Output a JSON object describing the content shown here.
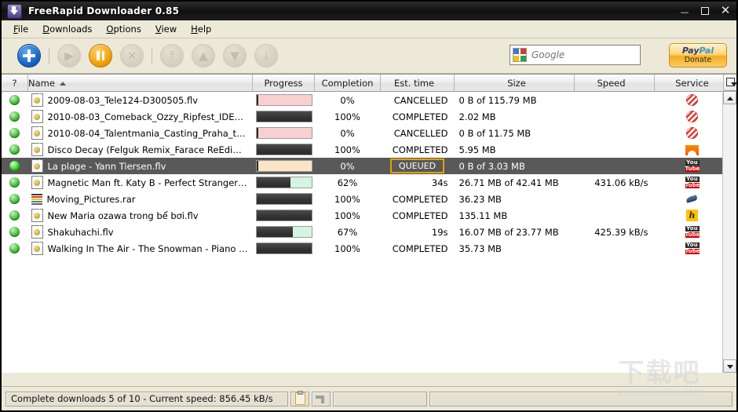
{
  "window": {
    "title": "FreeRapid Downloader 0.85",
    "icon": "download-arrow-icon",
    "minimize": "–",
    "maximize": "▢",
    "close": "✕"
  },
  "menu": {
    "items": [
      {
        "label": "File",
        "mnemonic": "F"
      },
      {
        "label": "Downloads",
        "mnemonic": "D"
      },
      {
        "label": "Options",
        "mnemonic": "O"
      },
      {
        "label": "View",
        "mnemonic": "V"
      },
      {
        "label": "Help",
        "mnemonic": "H"
      }
    ]
  },
  "toolbar": {
    "buttons": [
      {
        "name": "add-new-download",
        "icon": "plus-icon",
        "state": "enabled"
      },
      {
        "name": "resume-download",
        "icon": "play-icon",
        "state": "disabled"
      },
      {
        "name": "pause-download",
        "icon": "pause-icon",
        "state": "enabled"
      },
      {
        "name": "cancel-download",
        "icon": "cross-icon",
        "state": "disabled"
      },
      {
        "name": "move-to-top",
        "icon": "move-top-icon",
        "state": "disabled"
      },
      {
        "name": "move-up",
        "icon": "move-up-icon",
        "state": "disabled"
      },
      {
        "name": "move-down",
        "icon": "move-down-icon",
        "state": "disabled"
      },
      {
        "name": "move-to-bottom",
        "icon": "move-bottom-icon",
        "state": "disabled"
      }
    ],
    "search": {
      "placeholder": "Google",
      "value": "",
      "icon": "google-icon"
    },
    "paypal": {
      "brand_pay": "Pay",
      "brand_pal": "Pal",
      "label": "Donate"
    }
  },
  "table": {
    "columns": [
      {
        "key": "status",
        "label": "?"
      },
      {
        "key": "name",
        "label": "Name",
        "sorted": "asc",
        "sort_arrow": "▲"
      },
      {
        "key": "progress",
        "label": "Progress"
      },
      {
        "key": "completion",
        "label": "Completion"
      },
      {
        "key": "est_time",
        "label": "Est. time"
      },
      {
        "key": "size",
        "label": "Size"
      },
      {
        "key": "speed",
        "label": "Speed"
      },
      {
        "key": "service",
        "label": "Service"
      }
    ],
    "column_chooser_icon": "column-chooser-icon",
    "rows": [
      {
        "status_icon": "green-ball-icon",
        "file_icon": "flv-file-icon",
        "name": "2009-08-03_Tele124-D300505.flv",
        "progress_percent": 0,
        "progress_style": "cancelled",
        "completion": "0%",
        "est_time": "CANCELLED",
        "size": "0 B of 115.79 MB",
        "speed": "",
        "service": "megaupload-icon",
        "selected": false
      },
      {
        "status_icon": "green-ball-icon",
        "file_icon": "flv-file-icon",
        "name": "2010-08-03_Comeback_Ozzy_Ripfest_IDE…",
        "progress_percent": 100,
        "progress_style": "completed",
        "completion": "100%",
        "est_time": "COMPLETED",
        "size": "2.02 MB",
        "speed": "",
        "service": "megaupload-icon",
        "selected": false
      },
      {
        "status_icon": "green-ball-icon",
        "file_icon": "flv-file-icon",
        "name": "2010-08-04_Talentmania_Casting_Praha_tn…",
        "progress_percent": 0,
        "progress_style": "cancelled",
        "completion": "0%",
        "est_time": "CANCELLED",
        "size": "0 B of 11.75 MB",
        "speed": "",
        "service": "megaupload-icon",
        "selected": false
      },
      {
        "status_icon": "green-ball-icon",
        "file_icon": "flv-file-icon",
        "name": "Disco Decay (Felguk Remix_Farace ReEdi…",
        "progress_percent": 100,
        "progress_style": "completed",
        "completion": "100%",
        "est_time": "COMPLETED",
        "size": "5.95 MB",
        "speed": "",
        "service": "soundcloud-icon",
        "selected": false
      },
      {
        "status_icon": "green-ball-icon",
        "file_icon": "flv-file-icon",
        "name": "La plage - Yann Tiersen.flv",
        "progress_percent": 0,
        "progress_style": "queued",
        "completion": "0%",
        "est_time": "QUEUED",
        "est_time_focused": true,
        "size": "0 B of 3.03 MB",
        "speed": "",
        "service": "youtube-icon",
        "selected": true
      },
      {
        "status_icon": "green-ball-icon",
        "file_icon": "flv-file-icon",
        "name": "Magnetic Man ft. Katy B - Perfect Stranger,…",
        "progress_percent": 62,
        "progress_style": "downloading",
        "completion": "62%",
        "est_time": "34s",
        "size": "26.71 MB of 42.41 MB",
        "speed": "431.06 kB/s",
        "service": "youtube-icon",
        "selected": false
      },
      {
        "status_icon": "green-ball-icon",
        "file_icon": "rar-archive-icon",
        "name": "Moving_Pictures.rar",
        "progress_percent": 100,
        "progress_style": "completed",
        "completion": "100%",
        "est_time": "COMPLETED",
        "size": "36.23 MB",
        "speed": "",
        "service": "rapidshare-icon",
        "selected": false
      },
      {
        "status_icon": "green-ball-icon",
        "file_icon": "flv-file-icon",
        "name": "New Maria ozawa trong bể bơi.flv",
        "progress_percent": 100,
        "progress_style": "completed",
        "completion": "100%",
        "est_time": "COMPLETED",
        "size": "135.11 MB",
        "speed": "",
        "service": "hotfile-icon",
        "selected": false
      },
      {
        "status_icon": "green-ball-icon",
        "file_icon": "flv-file-icon",
        "name": "Shakuhachi.flv",
        "progress_percent": 67,
        "progress_style": "downloading",
        "completion": "67%",
        "est_time": "19s",
        "size": "16.07 MB of 23.77 MB",
        "speed": "425.39 kB/s",
        "service": "youtube-icon",
        "selected": false
      },
      {
        "status_icon": "green-ball-icon",
        "file_icon": "flv-file-icon",
        "name": "Walking In The Air - The Snowman - Piano …",
        "progress_percent": 100,
        "progress_style": "completed",
        "completion": "100%",
        "est_time": "COMPLETED",
        "size": "35.73 MB",
        "speed": "",
        "service": "youtube-icon",
        "selected": false
      }
    ]
  },
  "scrollbar": {
    "up_arrow": "▲",
    "down_arrow": "▼"
  },
  "statusbar": {
    "message": "Complete downloads 5 of 10 - Current speed: 856.45 kB/s",
    "clipboard_icon": "clipboard-monitor-icon",
    "tap_icon": "speed-limiter-icon"
  },
  "watermark": {
    "cn": "下载吧",
    "url": "www.xiazaiba.com"
  },
  "colors": {
    "accent_blue": "#1366c8",
    "accent_orange": "#f2a007",
    "cancelled_pink": "#f9d0d0",
    "queued_cream": "#fbe5c4",
    "downloading_mint": "#d4f5e2",
    "progress_fill": "#343434",
    "selection_gray": "#595959",
    "focus_gold": "#e0a300"
  }
}
